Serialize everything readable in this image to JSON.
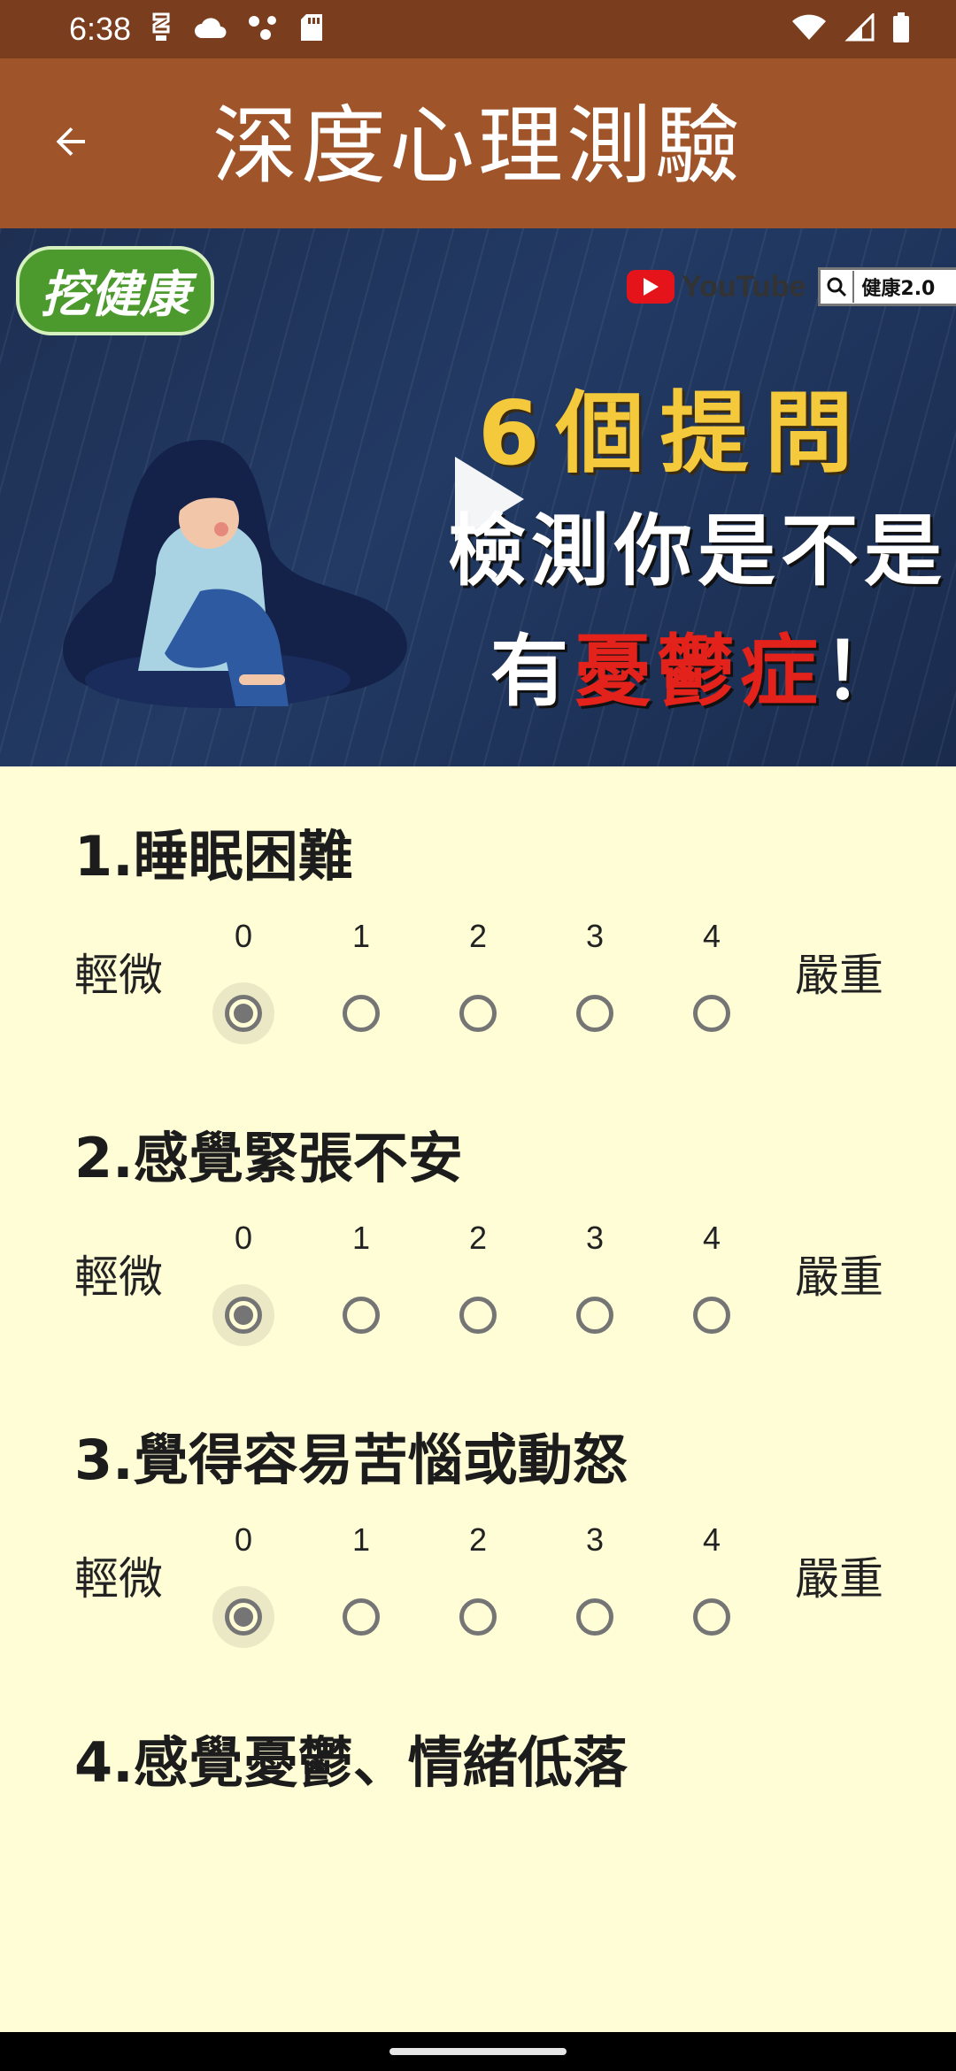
{
  "status_bar": {
    "time": "6:38"
  },
  "app_bar": {
    "title": "深度心理測驗"
  },
  "video": {
    "logo_text": "挖健康",
    "yt_label": "YouTube",
    "search_text": "健康2.0",
    "line1": "6個提問",
    "line2": "檢測你是不是",
    "line3_prefix": "有",
    "line3_highlight": "憂鬱症",
    "line3_suffix": "！"
  },
  "scale": {
    "low_label": "輕微",
    "high_label": "嚴重",
    "options": [
      "0",
      "1",
      "2",
      "3",
      "4"
    ]
  },
  "questions": [
    {
      "title": "1.睡眠困難",
      "selected": 0
    },
    {
      "title": "2.感覺緊張不安",
      "selected": 0
    },
    {
      "title": "3.覺得容易苦惱或動怒",
      "selected": 0
    },
    {
      "title": "4.感覺憂鬱、情緒低落"
    }
  ],
  "colors": {
    "status_bar": "#7a3d1e",
    "app_bar": "#a0542a",
    "background": "#fffdd6",
    "radio": "#757575"
  }
}
